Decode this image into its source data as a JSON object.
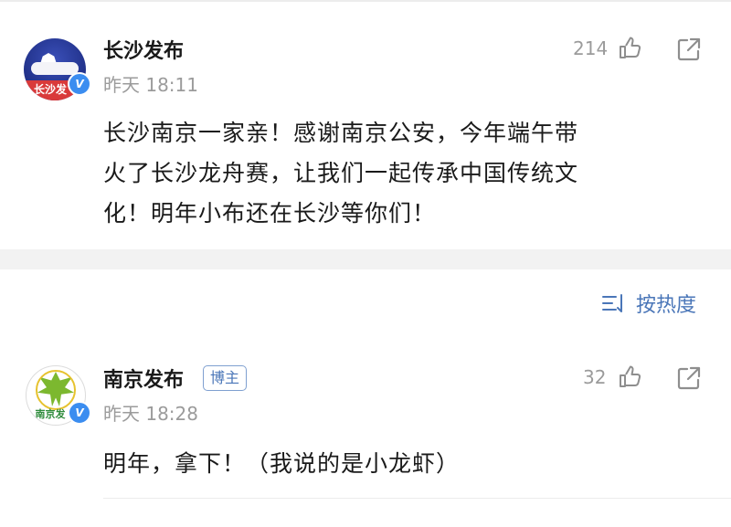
{
  "post": {
    "author": "长沙发布",
    "avatar_text": "长沙发",
    "time": "昨天 18:11",
    "like_count": "214",
    "content_lines": [
      "长沙南京一家亲！感谢南京公安，今年端午带",
      "火了长沙龙舟赛，让我们一起传承中国传统文",
      "化！明年小布还在长沙等你们！"
    ]
  },
  "sort": {
    "label": "按热度"
  },
  "comment": {
    "author": "南京发布",
    "avatar_text": "南京发",
    "badge": "博主",
    "time": "昨天 18:28",
    "like_count": "32",
    "content": "明年，拿下！（我说的是小龙虾）"
  },
  "verify_mark": "V",
  "colors": {
    "accent_blue": "#4a76b8",
    "verify_blue": "#3b8df0",
    "muted_gray": "#9b9b9b"
  }
}
